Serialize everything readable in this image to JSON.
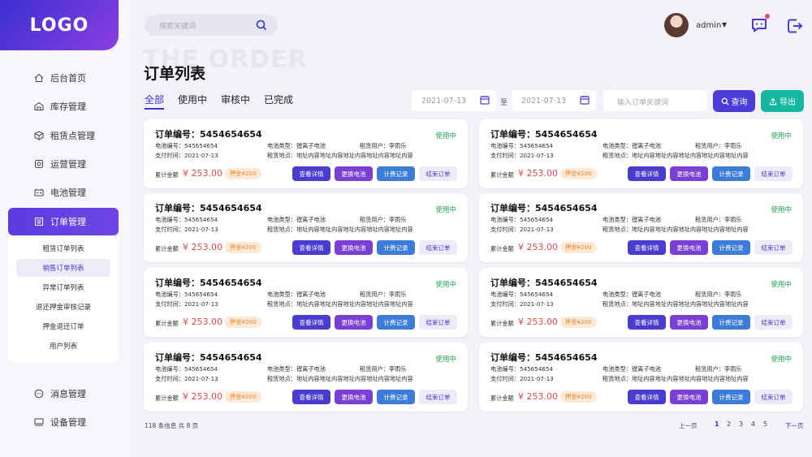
{
  "app": {
    "logo": "LOGO"
  },
  "search": {
    "placeholder": "搜索关键词"
  },
  "user": {
    "name": "admin"
  },
  "sidebar": {
    "items": [
      {
        "label": "后台首页",
        "icon": "home-icon"
      },
      {
        "label": "库存管理",
        "icon": "warehouse-icon"
      },
      {
        "label": "租赁点管理",
        "icon": "box-icon"
      },
      {
        "label": "运营管理",
        "icon": "gear-icon"
      },
      {
        "label": "电池管理",
        "icon": "battery-icon"
      },
      {
        "label": "订单管理",
        "icon": "document-icon"
      },
      {
        "label": "消息管理",
        "icon": "message-icon"
      },
      {
        "label": "设备管理",
        "icon": "device-icon"
      }
    ],
    "sub_items": [
      {
        "label": "租赁订单列表"
      },
      {
        "label": "销售订单列表"
      },
      {
        "label": "异常订单列表"
      },
      {
        "label": "退还押金审核记录"
      },
      {
        "label": "押金退还订单"
      },
      {
        "label": "用户列表"
      }
    ],
    "active_item": "订单管理",
    "active_sub_item": "销售订单列表"
  },
  "page": {
    "watermark": "THE ORDER",
    "title": "订单列表"
  },
  "tabs": [
    {
      "label": "全部"
    },
    {
      "label": "使用中"
    },
    {
      "label": "审核中"
    },
    {
      "label": "已完成"
    }
  ],
  "filters": {
    "date_from": "2021-07-13",
    "date_to": "2021-07-13",
    "separator": "至",
    "keyword_placeholder": "输入订单关键词",
    "query_label": "查询",
    "export_label": "导出"
  },
  "card_labels": {
    "order_no": "订单编号：",
    "battery_no": "电池编号：",
    "pay_time": "支付时间：",
    "battery_type": "电池类型：",
    "rent_place": "租赁地点：",
    "rent_user": "租赁用户：",
    "total": "累计金额",
    "btn_detail": "查看详情",
    "btn_replace": "更换电池",
    "btn_billing": "计费记录",
    "btn_end": "结束订单"
  },
  "orders": [
    {
      "order_no": "5454654654",
      "status": "使用中",
      "battery_no": "545654654",
      "pay_time": "2021-07-13",
      "battery_type": "镗离子电池",
      "rent_user": "李雨乐",
      "rent_place": "地址内容地址内容地址内容地址内容地址内容",
      "amount": "¥ 253.00",
      "deposit": "押金¥200"
    },
    {
      "order_no": "5454654654",
      "status": "使用中",
      "battery_no": "545654654",
      "pay_time": "2021-07-13",
      "battery_type": "镗离子电池",
      "rent_user": "李雨乐",
      "rent_place": "地址内容地址内容地址内容地址内容地址内容",
      "amount": "¥ 253.00",
      "deposit": "押金¥200"
    },
    {
      "order_no": "5454654654",
      "status": "使用中",
      "battery_no": "545654654",
      "pay_time": "2021-07-13",
      "battery_type": "镗离子电池",
      "rent_user": "李雨乐",
      "rent_place": "地址内容地址内容地址内容地址内容地址内容",
      "amount": "¥ 253.00",
      "deposit": "押金¥200"
    },
    {
      "order_no": "5454654654",
      "status": "使用中",
      "battery_no": "545654654",
      "pay_time": "2021-07-13",
      "battery_type": "镗离子电池",
      "rent_user": "李雨乐",
      "rent_place": "地址内容地址内容地址内容地址内容地址内容",
      "amount": "¥ 253.00",
      "deposit": "押金¥200"
    },
    {
      "order_no": "5454654654",
      "status": "使用中",
      "battery_no": "545654654",
      "pay_time": "2021-07-13",
      "battery_type": "镗离子电池",
      "rent_user": "李雨乐",
      "rent_place": "地址内容地址内容地址内容地址内容地址内容",
      "amount": "¥ 253.00",
      "deposit": "押金¥200"
    },
    {
      "order_no": "5454654654",
      "status": "使用中",
      "battery_no": "545654654",
      "pay_time": "2021-07-13",
      "battery_type": "镗离子电池",
      "rent_user": "李雨乐",
      "rent_place": "地址内容地址内容地址内容地址内容地址内容",
      "amount": "¥ 253.00",
      "deposit": "押金¥200"
    },
    {
      "order_no": "5454654654",
      "status": "使用中",
      "battery_no": "545654654",
      "pay_time": "2021-07-13",
      "battery_type": "镗离子电池",
      "rent_user": "李雨乐",
      "rent_place": "地址内容地址内容地址内容地址内容地址内容",
      "amount": "¥ 253.00",
      "deposit": "押金¥200"
    },
    {
      "order_no": "5454654654",
      "status": "使用中",
      "battery_no": "545654654",
      "pay_time": "2021-07-13",
      "battery_type": "镗离子电池",
      "rent_user": "李雨乐",
      "rent_place": "地址内容地址内容地址内容地址内容地址内容",
      "amount": "¥ 253.00",
      "deposit": "押金¥200"
    }
  ],
  "pagination": {
    "info": "118 条信息 共 8 页",
    "prev": "上一页",
    "next": "下一页",
    "pages": [
      "1",
      "2",
      "3",
      "4",
      "5"
    ],
    "current": "1"
  },
  "colors": {
    "primary": "#4a3cd6",
    "accent_purple": "#7b3fd6",
    "accent_blue": "#3d7bd8",
    "export_green": "#16b7a0",
    "status_green": "#1aa34a",
    "price_red": "#e34b4b"
  }
}
